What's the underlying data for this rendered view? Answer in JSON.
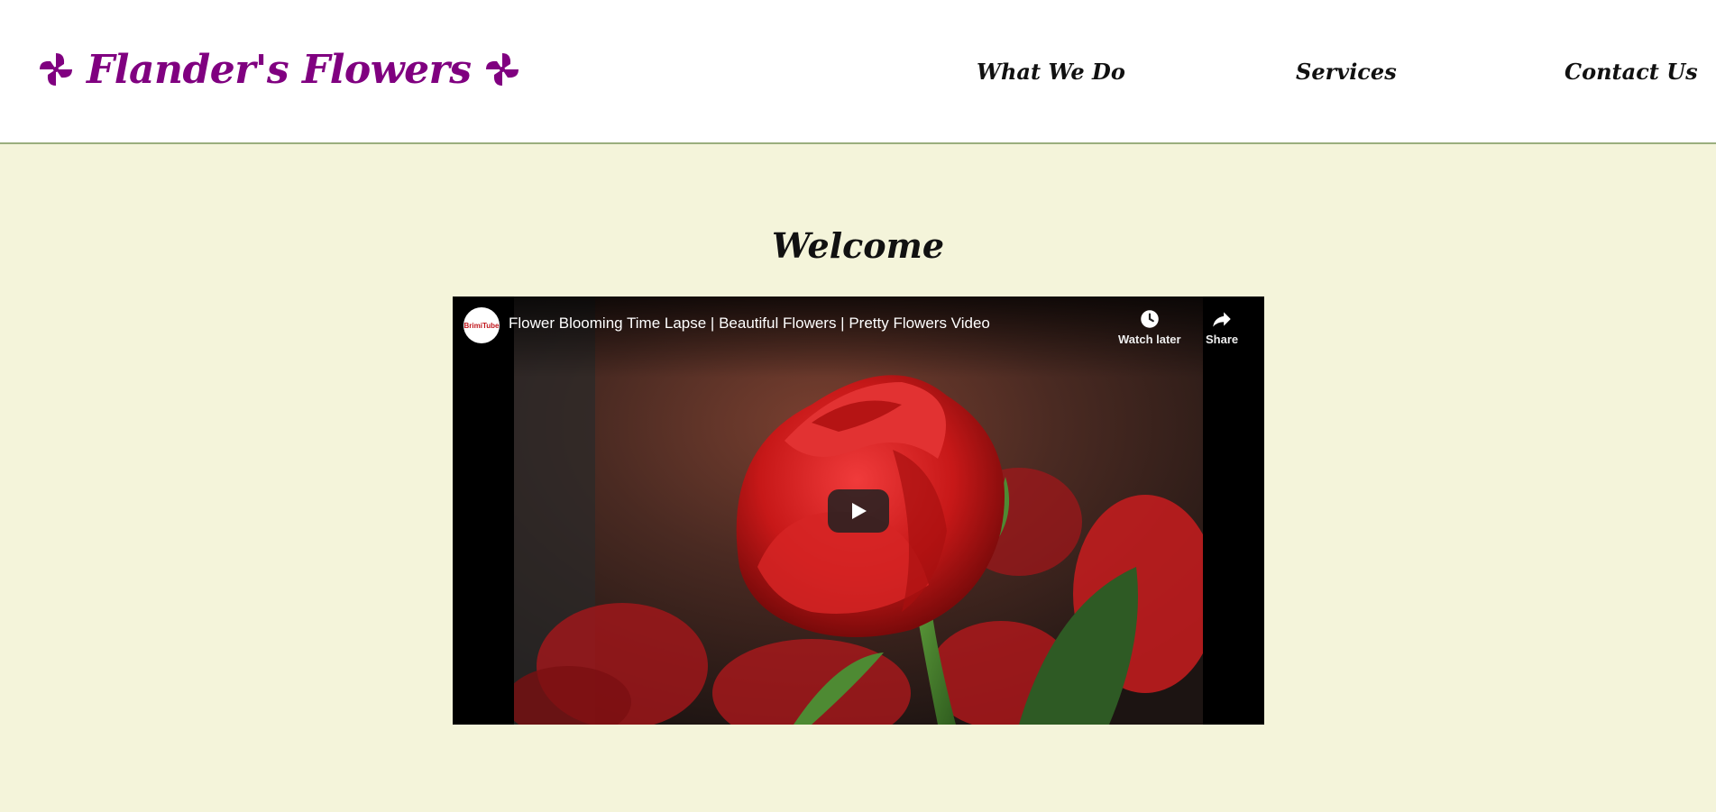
{
  "header": {
    "brand": "Flander's Flowers",
    "nav": [
      {
        "label": "What We Do"
      },
      {
        "label": "Services"
      },
      {
        "label": "Contact Us"
      }
    ]
  },
  "main": {
    "heading": "Welcome",
    "video": {
      "channel": "BrimiTube",
      "title": "Flower Blooming Time Lapse | Beautiful Flowers | Pretty Flowers Video",
      "watch_later_label": "Watch later",
      "share_label": "Share"
    }
  },
  "colors": {
    "brand": "#800080",
    "page_background": "#f4f4da",
    "header_border": "#9aae7e"
  },
  "icons": [
    "pinwheel-icon",
    "clock-icon",
    "share-arrow-icon",
    "play-icon"
  ]
}
